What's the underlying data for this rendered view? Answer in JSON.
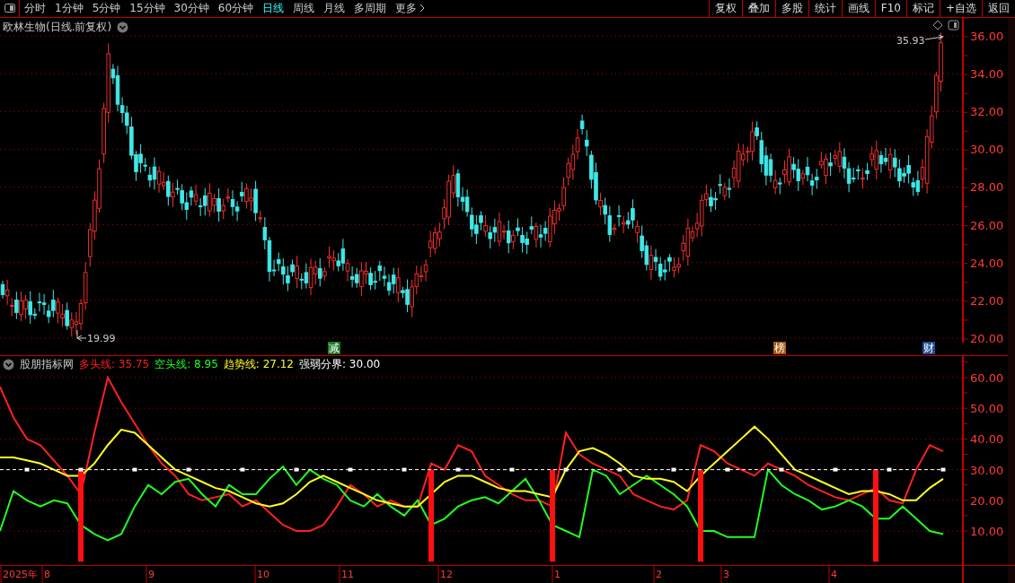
{
  "toolbar": {
    "periods": [
      {
        "label": "分时",
        "selected": false
      },
      {
        "label": "1分钟",
        "selected": false
      },
      {
        "label": "5分钟",
        "selected": false
      },
      {
        "label": "15分钟",
        "selected": false
      },
      {
        "label": "30分钟",
        "selected": false
      },
      {
        "label": "60分钟",
        "selected": false
      },
      {
        "label": "日线",
        "selected": true
      },
      {
        "label": "周线",
        "selected": false
      },
      {
        "label": "月线",
        "selected": false
      },
      {
        "label": "多周期",
        "selected": false
      },
      {
        "label": "更多",
        "selected": false
      }
    ],
    "actions": [
      "复权",
      "叠加",
      "多股",
      "统计",
      "画线",
      "F10",
      "标记",
      "+自选",
      "返回"
    ]
  },
  "main_chart": {
    "title": "欧林生物(日线.前复权)",
    "price_axis": [
      "36.00",
      "34.00",
      "32.00",
      "30.00",
      "28.00",
      "26.00",
      "24.00",
      "22.00",
      "20.00"
    ],
    "high_label": "35.93",
    "low_label": "19.99",
    "events": [
      {
        "label": "减",
        "color": "#1c7a2a"
      },
      {
        "label": "榜",
        "color": "#a85a10"
      },
      {
        "label": "财",
        "color": "#1d4f96"
      }
    ]
  },
  "indicator": {
    "name": "股朋指标网",
    "legend": [
      {
        "label": "多头线: 35.75",
        "color": "#ff2020"
      },
      {
        "label": "空头线: 8.95",
        "color": "#20ff20"
      },
      {
        "label": "趋势线: 27.12",
        "color": "#ffff20"
      },
      {
        "label": "强弱分界: 30.00",
        "color": "#ffffff"
      }
    ],
    "chart_data": {
      "type": "line",
      "grid": true,
      "ylim": [
        -1.1,
        67
      ],
      "yticks": [
        {
          "value": 60,
          "label": "60.00"
        },
        {
          "value": 50,
          "label": "50.00"
        },
        {
          "value": 40,
          "label": "40.00"
        },
        {
          "value": 30,
          "label": "30.00"
        },
        {
          "value": 20,
          "label": "20.00"
        },
        {
          "value": 10,
          "label": "10.00"
        }
      ],
      "series": [
        {
          "color": "#ff2020",
          "values": [
            57,
            47,
            40,
            38,
            33,
            28,
            22,
            42,
            60,
            52,
            45,
            38,
            32,
            28,
            22,
            20,
            21,
            22,
            18,
            20,
            16,
            12,
            10,
            10,
            12,
            18,
            25,
            22,
            18,
            20,
            18,
            18,
            32,
            30,
            38,
            36,
            28,
            25,
            22,
            20,
            20,
            18,
            42,
            35,
            32,
            30,
            28,
            22,
            20,
            18,
            17,
            20,
            38,
            36,
            32,
            30,
            28,
            32,
            30,
            28,
            25,
            23,
            21,
            20,
            22,
            24,
            20,
            19,
            30,
            38,
            36
          ]
        },
        {
          "color": "#20ff20",
          "values": [
            10,
            23,
            20,
            18,
            20,
            19,
            12,
            9,
            7,
            9,
            18,
            25,
            22,
            26,
            27,
            22,
            18,
            25,
            22,
            22,
            27,
            31,
            25,
            30,
            27,
            25,
            20,
            18,
            22,
            18,
            15,
            20,
            12,
            14,
            18,
            20,
            21,
            19,
            23,
            27,
            20,
            12,
            10,
            8,
            30,
            28,
            22,
            25,
            28,
            25,
            22,
            18,
            10,
            10,
            8,
            8,
            8,
            30,
            25,
            22,
            20,
            17,
            18,
            20,
            18,
            14,
            14,
            18,
            14,
            10,
            9
          ]
        },
        {
          "color": "#ffff20",
          "values": [
            34,
            34,
            33,
            32,
            30,
            28,
            28,
            32,
            38,
            43,
            42,
            38,
            34,
            30,
            28,
            26,
            24,
            23,
            21,
            19,
            18,
            19,
            22,
            26,
            28,
            26,
            24,
            22,
            20,
            19,
            18,
            18,
            22,
            26,
            28,
            28,
            26,
            24,
            23,
            23,
            22,
            21,
            30,
            36,
            37,
            35,
            32,
            28,
            27,
            27,
            26,
            23,
            28,
            32,
            36,
            40,
            44,
            40,
            35,
            30,
            28,
            26,
            24,
            22,
            23,
            23,
            22,
            20,
            20,
            24,
            27
          ]
        },
        {
          "type": "bar",
          "color": "#ff1010",
          "values": [
            null,
            null,
            null,
            null,
            null,
            null,
            30,
            null,
            null,
            null,
            null,
            null,
            null,
            null,
            null,
            null,
            null,
            null,
            null,
            null,
            null,
            null,
            null,
            null,
            null,
            null,
            null,
            null,
            null,
            null,
            null,
            null,
            30,
            null,
            null,
            null,
            null,
            null,
            null,
            null,
            null,
            30,
            null,
            null,
            null,
            null,
            null,
            null,
            null,
            null,
            null,
            null,
            30,
            null,
            null,
            null,
            null,
            null,
            null,
            null,
            null,
            null,
            null,
            null,
            null,
            30,
            null,
            null,
            null,
            null,
            null
          ]
        },
        {
          "line_style": "dashed",
          "color": "#ffffff",
          "values": [
            30,
            30,
            30,
            30,
            30,
            30,
            30,
            30,
            30,
            30,
            30,
            30,
            30,
            30,
            30,
            30,
            30,
            30,
            30,
            30,
            30,
            30,
            30,
            30,
            30,
            30,
            30,
            30,
            30,
            30,
            30,
            30,
            30,
            30,
            30,
            30,
            30,
            30,
            30,
            30,
            30,
            30,
            30,
            30,
            30,
            30,
            30,
            30,
            30,
            30,
            30,
            30,
            30,
            30,
            30,
            30,
            30,
            30,
            30,
            30,
            30,
            30,
            30,
            30,
            30,
            30,
            30,
            30,
            30,
            30,
            30
          ]
        }
      ]
    },
    "date_axis": [
      "2025年",
      "8",
      "9",
      "10",
      "11",
      "12",
      "1",
      "2",
      "3",
      "4"
    ]
  }
}
